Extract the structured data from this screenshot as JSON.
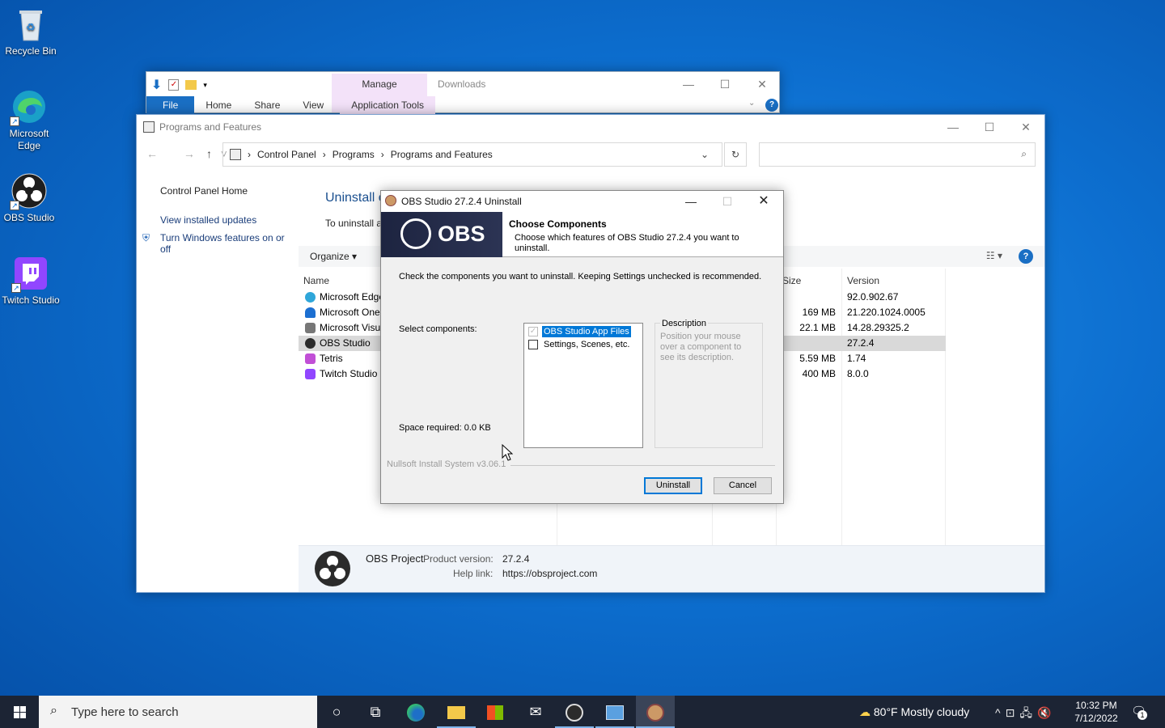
{
  "desktop": {
    "icons": [
      {
        "label": "Recycle Bin"
      },
      {
        "label": "Microsoft Edge"
      },
      {
        "label": "OBS Studio"
      },
      {
        "label": "Twitch Studio"
      }
    ]
  },
  "explorer": {
    "manage_label": "Manage",
    "title": "Downloads",
    "tabs": [
      "File",
      "Home",
      "Share",
      "View",
      "Application Tools"
    ]
  },
  "cpanel": {
    "title": "Programs and Features",
    "breadcrumb": [
      "Control Panel",
      "Programs",
      "Programs and Features"
    ],
    "sidebar": [
      "Control Panel Home",
      "View installed updates",
      "Turn Windows features on or off"
    ],
    "heading": "Uninstall o",
    "subtext": "To uninstall a",
    "organize_label": "Organize",
    "columns": {
      "name": "Name",
      "size": "Size",
      "version": "Version"
    },
    "rows": [
      {
        "name": "Microsoft Edge",
        "size": "",
        "version": "92.0.902.67",
        "icon_color": "#2fa6d9"
      },
      {
        "name": "Microsoft One",
        "size": "169 MB",
        "version": "21.220.1024.0005",
        "icon_color": "#1c6fd1"
      },
      {
        "name": "Microsoft Visu",
        "size": "22.1 MB",
        "version": "14.28.29325.2",
        "icon_color": "#777777"
      },
      {
        "name": "OBS Studio",
        "size": "",
        "version": "27.2.4",
        "icon_color": "#2b2b2b"
      },
      {
        "name": "Tetris",
        "size": "5.59 MB",
        "version": "1.74",
        "icon_color": "#c14fd6"
      },
      {
        "name": "Twitch Studio",
        "size": "400 MB",
        "version": "8.0.0",
        "icon_color": "#9146ff"
      }
    ],
    "details": {
      "publisher": "OBS Project",
      "product_version_label": "Product version:",
      "product_version": "27.2.4",
      "help_link_label": "Help link:",
      "help_link": "https://obsproject.com"
    }
  },
  "dialog": {
    "title": "OBS Studio 27.2.4 Uninstall",
    "banner_text": "OBS",
    "header_title": "Choose Components",
    "header_sub": "Choose which features of OBS Studio 27.2.4 you want to uninstall.",
    "instructions": "Check the components you want to uninstall. Keeping Settings unchecked is recommended.",
    "select_label": "Select components:",
    "components": [
      {
        "label": "OBS Studio App Files",
        "checked": true,
        "disabled": true
      },
      {
        "label": "Settings, Scenes, etc.",
        "checked": false,
        "disabled": false
      }
    ],
    "description_label": "Description",
    "description_text": "Position your mouse over a component to see its description.",
    "space_required": "Space required: 0.0 KB",
    "brand": "Nullsoft Install System v3.06.1",
    "uninstall_label": "Uninstall",
    "cancel_label": "Cancel"
  },
  "taskbar": {
    "search_placeholder": "Type here to search",
    "weather": "80°F  Mostly cloudy",
    "time": "10:32 PM",
    "date": "7/12/2022",
    "notification_count": "1"
  }
}
